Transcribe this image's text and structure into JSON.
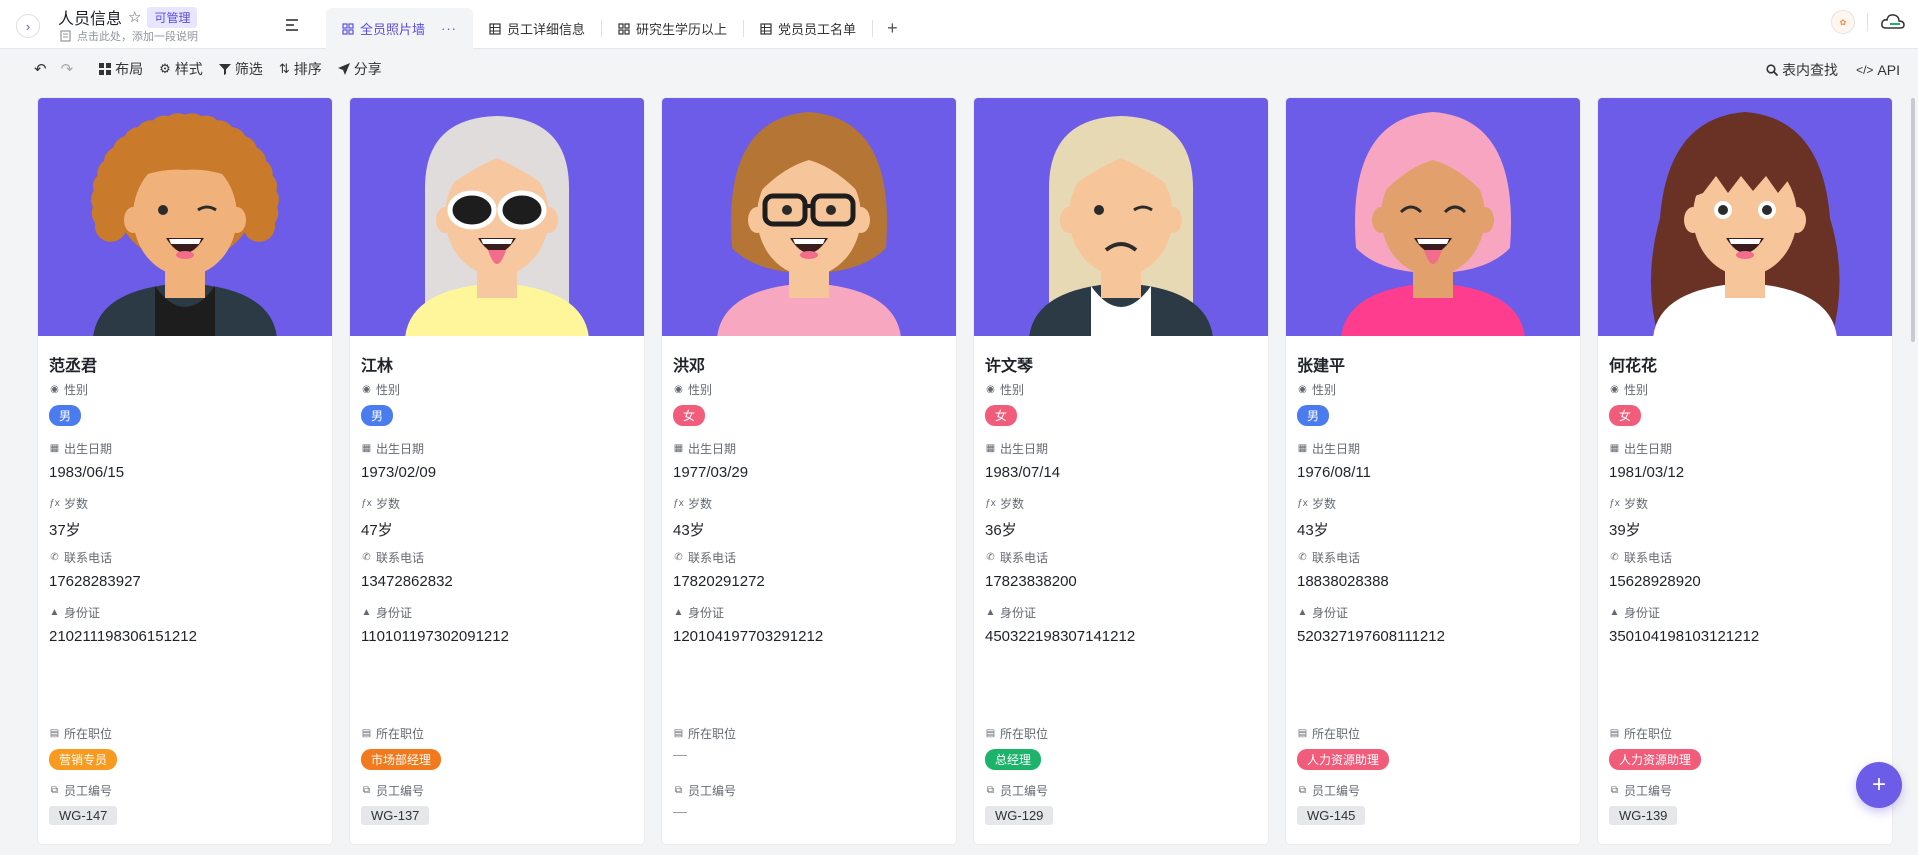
{
  "app": {
    "title": "人员信息",
    "badge": "可管理",
    "description": "点击此处，添加一段说明"
  },
  "tabs": [
    {
      "label": "全员照片墙",
      "icon": "gallery-icon",
      "active": true
    },
    {
      "label": "员工详细信息",
      "icon": "grid-icon",
      "active": false
    },
    {
      "label": "研究生学历以上",
      "icon": "gallery-icon",
      "active": false
    },
    {
      "label": "党员员工名单",
      "icon": "grid-icon",
      "active": false
    }
  ],
  "toolbar": {
    "layout": "布局",
    "style": "样式",
    "filter": "筛选",
    "sort": "排序",
    "share": "分享",
    "find": "表内查找",
    "api": "API"
  },
  "labels": {
    "gender": "性别",
    "birth": "出生日期",
    "age": "岁数",
    "phone": "联系电话",
    "id": "身份证",
    "position": "所在职位",
    "emp_no": "员工编号",
    "empty": "—"
  },
  "colors": {
    "accent": "#6c5ce7",
    "male": "#4a7cf0",
    "female": "#f25c7b"
  },
  "people": [
    {
      "name": "范丞君",
      "gender": "男",
      "birth": "1983/06/15",
      "age": "37岁",
      "phone": "17628283927",
      "id": "210211198306151212",
      "position": "营销专员",
      "position_color": "#f79a1f",
      "emp_no": "WG-147"
    },
    {
      "name": "江林",
      "gender": "男",
      "birth": "1973/02/09",
      "age": "47岁",
      "phone": "13472862832",
      "id": "110101197302091212",
      "position": "市场部经理",
      "position_color": "#f27a1e",
      "emp_no": "WG-137"
    },
    {
      "name": "洪邓",
      "gender": "女",
      "birth": "1977/03/29",
      "age": "43岁",
      "phone": "17820291272",
      "id": "120104197703291212",
      "position": "",
      "position_color": "",
      "emp_no": ""
    },
    {
      "name": "许文琴",
      "gender": "女",
      "birth": "1983/07/14",
      "age": "36岁",
      "phone": "17823838200",
      "id": "450322198307141212",
      "position": "总经理",
      "position_color": "#1db36b",
      "emp_no": "WG-129"
    },
    {
      "name": "张建平",
      "gender": "男",
      "birth": "1976/08/11",
      "age": "43岁",
      "phone": "18838028388",
      "id": "520327197608111212",
      "position": "人力资源助理",
      "position_color": "#f25c7b",
      "emp_no": "WG-145"
    },
    {
      "name": "何花花",
      "gender": "女",
      "birth": "1981/03/12",
      "age": "39岁",
      "phone": "15628928920",
      "id": "350104198103121212",
      "position": "人力资源助理",
      "position_color": "#f25c7b",
      "emp_no": "WG-139"
    }
  ]
}
